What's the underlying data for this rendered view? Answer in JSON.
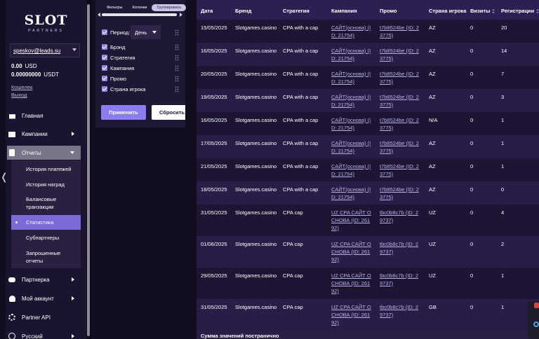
{
  "sidebar": {
    "logo_main": "SLOT",
    "logo_sub": "PARTNERS",
    "account_email": "speskov@leads.su",
    "balances": [
      {
        "amount": "0.00",
        "currency": "USD"
      },
      {
        "amount": "0.00000000",
        "currency": "USDT"
      }
    ],
    "wallet_link": "Кошелек",
    "logout_link": "Выход",
    "nav": {
      "home": "Главная",
      "campaigns": "Кампании",
      "reports": "Отчеты",
      "partnership": "Партнерка",
      "account": "Мой аккаунт",
      "api": "Partner API",
      "language": "Русский"
    },
    "reports_sub": {
      "payments": "История платежей",
      "rewards": "История наград",
      "balance_tx_line1": "Балансовые",
      "balance_tx_line2": "транзакции",
      "statistics": "Статистика",
      "subpartners": "Субпартнеры",
      "requested_line1": "Запрошенные",
      "requested_line2": "отчеты"
    }
  },
  "filters": {
    "tabs": [
      "Фильтры",
      "Колонки",
      "Группировать"
    ],
    "period_label": "Период:",
    "period_value": "День",
    "options": [
      "Брэнд",
      "Стратегия",
      "Кампания",
      "Промо",
      "Страна игрока"
    ],
    "apply": "Применить",
    "reset": "Сбросить"
  },
  "table": {
    "headers": {
      "date": "Дата",
      "brand": "Бренд",
      "strategy": "Стратегия",
      "campaign": "Кампания",
      "promo": "Промо",
      "country": "Страна игрока",
      "visits": "Визиты",
      "registrations": "Регистрации"
    },
    "rows": [
      {
        "date": "15/05/2025",
        "brand": "Slotgames.casino",
        "strategy": "CPA with a cap",
        "campaign": [
          "САЙТ(основа) (I",
          "D: 21754)"
        ],
        "promo": [
          "t7b8524be (ID: 2",
          "3775)"
        ],
        "country": "AZ",
        "visits": "0",
        "regs": "20"
      },
      {
        "date": "16/05/2025",
        "brand": "Slotgames.casino",
        "strategy": "CPA with a cap",
        "campaign": [
          "САЙТ(основа) (I",
          "D: 21754)"
        ],
        "promo": [
          "t7b8524be (ID: 2",
          "3775)"
        ],
        "country": "AZ",
        "visits": "0",
        "regs": "14"
      },
      {
        "date": "20/05/2025",
        "brand": "Slotgames.casino",
        "strategy": "CPA with a cap",
        "campaign": [
          "САЙТ(основа) (I",
          "D: 21754)"
        ],
        "promo": [
          "t7b8524be (ID: 2",
          "3775)"
        ],
        "country": "AZ",
        "visits": "0",
        "regs": "7"
      },
      {
        "date": "19/05/2025",
        "brand": "Slotgames.casino",
        "strategy": "CPA with a cap",
        "campaign": [
          "САЙТ(основа) (I",
          "D: 21754)"
        ],
        "promo": [
          "t7b8524be (ID: 2",
          "3775)"
        ],
        "country": "AZ",
        "visits": "0",
        "regs": "3"
      },
      {
        "date": "16/05/2025",
        "brand": "Slotgames.casino",
        "strategy": "CPA with a cap",
        "campaign": [
          "САЙТ(основа) (I",
          "D: 21754)"
        ],
        "promo": [
          "t7b8524be (ID: 2",
          "3775)"
        ],
        "country": "N/A",
        "visits": "0",
        "regs": "1"
      },
      {
        "date": "17/05/2025",
        "brand": "Slotgames.casino",
        "strategy": "CPA with a cap",
        "campaign": [
          "САЙТ(основа) (I",
          "D: 21754)"
        ],
        "promo": [
          "t7b8524be (ID: 2",
          "3775)"
        ],
        "country": "AZ",
        "visits": "0",
        "regs": "1"
      },
      {
        "date": "21/05/2025",
        "brand": "Slotgames.casino",
        "strategy": "CPA with a cap",
        "campaign": [
          "САЙТ(основа) (I",
          "D: 21754)"
        ],
        "promo": [
          "t7b8524be (ID: 2",
          "3775)"
        ],
        "country": "AZ",
        "visits": "0",
        "regs": "1"
      },
      {
        "date": "18/05/2025",
        "brand": "Slotgames.casino",
        "strategy": "CPA with a cap",
        "campaign": [
          "САЙТ(основа) (I",
          "D: 21754)"
        ],
        "promo": [
          "t7b8524be (ID: 2",
          "3775)"
        ],
        "country": "AZ",
        "visits": "0",
        "regs": "0"
      },
      {
        "date": "31/05/2025",
        "brand": "Slotgames.casino",
        "strategy": "CPA cap",
        "campaign": [
          "UZ CPA САЙТ О",
          "СНОВА (ID: 261",
          "92)"
        ],
        "promo": [
          "tbc0b8c7b (ID: 2",
          "9737)"
        ],
        "country": "UZ",
        "visits": "0",
        "regs": "4"
      },
      {
        "date": "01/06/2025",
        "brand": "Slotgames.casino",
        "strategy": "CPA cap",
        "campaign": [
          "UZ CPA САЙТ О",
          "СНОВА (ID: 261",
          "92)"
        ],
        "promo": [
          "tbc0b8c7b (ID: 2",
          "9737)"
        ],
        "country": "UZ",
        "visits": "0",
        "regs": "2"
      },
      {
        "date": "29/05/2025",
        "brand": "Slotgames.casino",
        "strategy": "CPA cap",
        "campaign": [
          "UZ CPA САЙТ О",
          "СНОВА (ID: 261",
          "92)"
        ],
        "promo": [
          "tbc0b8c7b (ID: 2",
          "9737)"
        ],
        "country": "UZ",
        "visits": "0",
        "regs": "1"
      },
      {
        "date": "31/05/2025",
        "brand": "Slotgames.casino",
        "strategy": "CPA cap",
        "campaign": [
          "UZ CPA САЙТ О",
          "СНОВА (ID: 261",
          "92)"
        ],
        "promo": [
          "tbc0b8c7b (ID: 2",
          "9737)"
        ],
        "country": "GB",
        "visits": "0",
        "regs": "1"
      }
    ],
    "footer": "Сумма значений постранично"
  }
}
